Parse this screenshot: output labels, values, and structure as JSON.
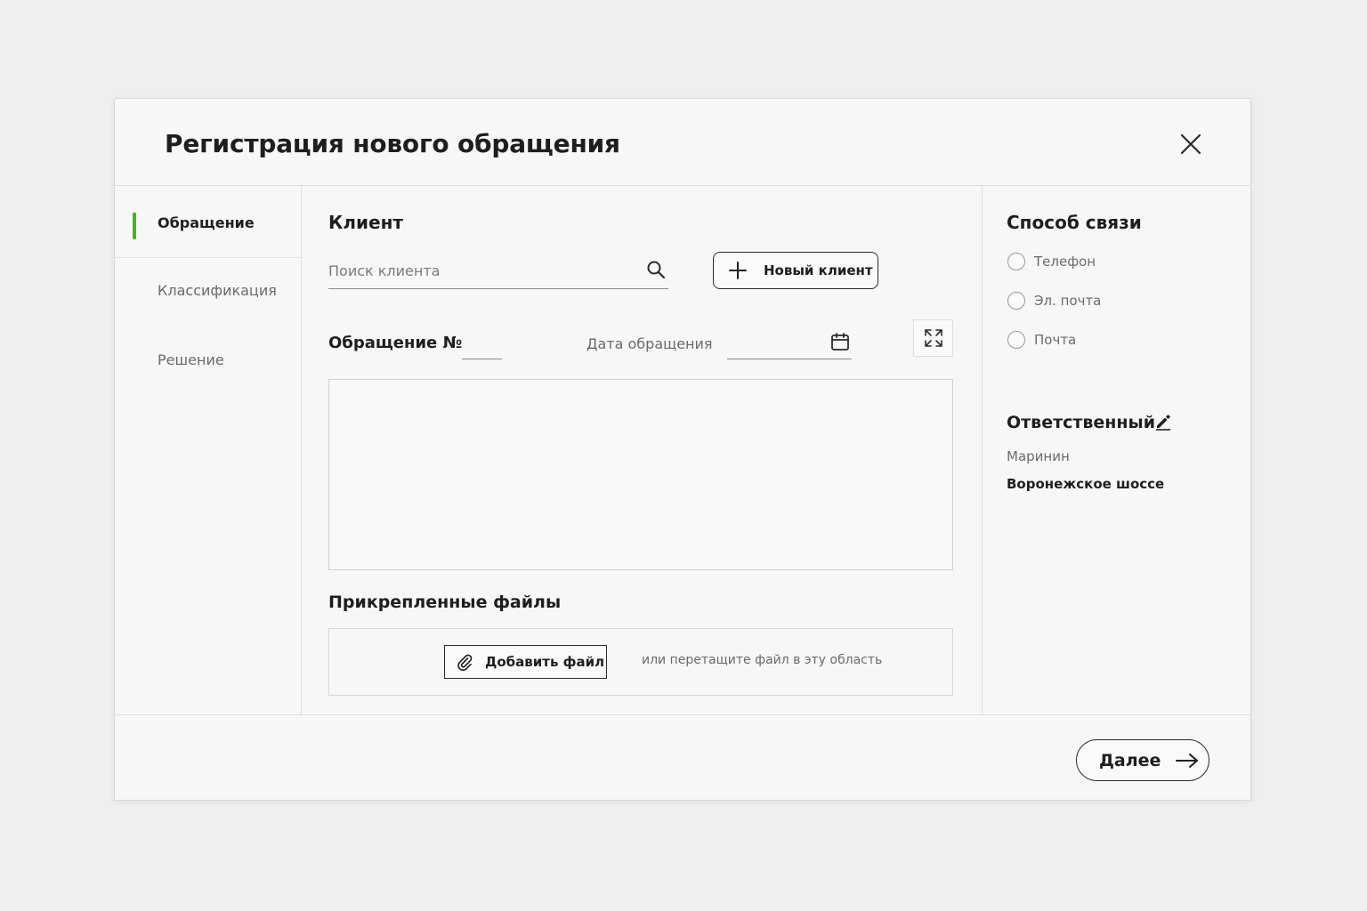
{
  "dialog": {
    "title": "Регистрация нового обращения",
    "close_icon": "close-icon"
  },
  "sidebar": {
    "items": [
      {
        "label": "Обращение",
        "active": true
      },
      {
        "label": "Классификация",
        "active": false
      },
      {
        "label": "Решение",
        "active": false
      }
    ],
    "accent_color": "#4caf2b"
  },
  "client": {
    "heading": "Клиент",
    "search_placeholder": "Поиск клиента",
    "search_value": "",
    "new_client_label": "Новый клиент"
  },
  "appeal": {
    "number_label": "Обращение №",
    "number_value": "",
    "date_label": "Дата обращения",
    "date_value": "",
    "text_value": ""
  },
  "attachments": {
    "heading": "Прикрепленные файлы",
    "add_file_label": "Добавить файл",
    "drop_hint": "или перетащите файл в эту область"
  },
  "contact_method": {
    "heading": "Способ связи",
    "options": [
      {
        "label": "Телефон",
        "selected": false
      },
      {
        "label": "Эл. почта",
        "selected": false
      },
      {
        "label": "Почта",
        "selected": false
      }
    ]
  },
  "responsible": {
    "heading": "Ответственный",
    "name": "Маринин",
    "location": "Воронежское шоссе"
  },
  "footer": {
    "next_label": "Далее"
  }
}
